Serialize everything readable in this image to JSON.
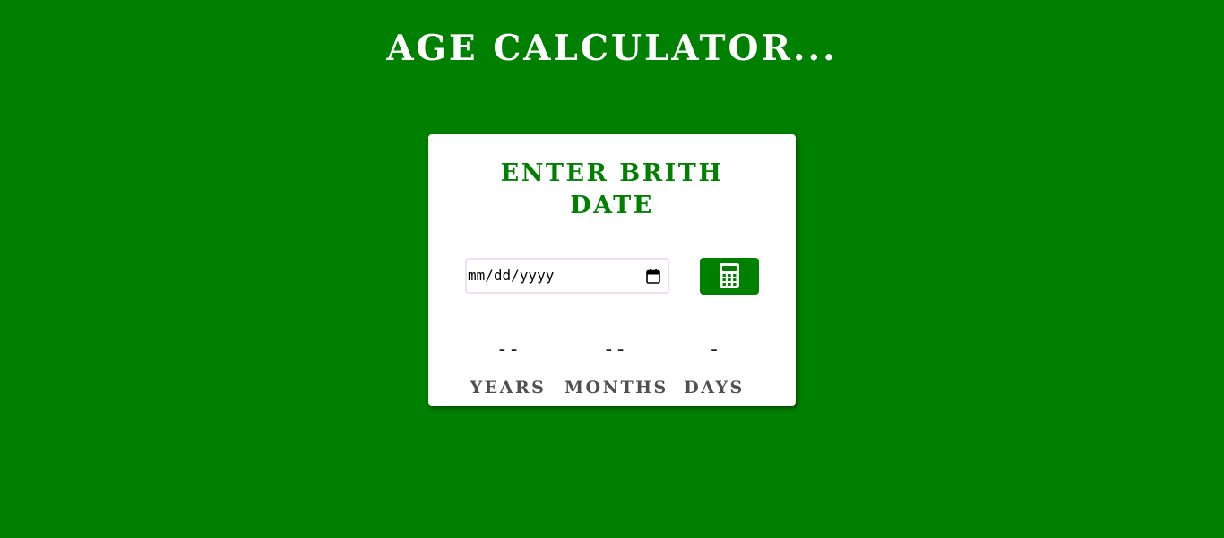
{
  "page": {
    "title": "AGE CALCULATOR..."
  },
  "card": {
    "heading": "ENTER BRITH DATE",
    "date_input": {
      "placeholder": "mm/dd/yyyy",
      "icon": "calendar-icon"
    },
    "calculate_button": {
      "icon": "calculator-icon"
    },
    "results": {
      "years": {
        "value": "--",
        "label": "YEARS"
      },
      "months": {
        "value": "--",
        "label": "MONTHS"
      },
      "days": {
        "value": "-",
        "label": "DAYS"
      }
    }
  },
  "colors": {
    "background": "#008000",
    "accent": "#008000",
    "card": "#ffffff",
    "label": "#505050"
  }
}
